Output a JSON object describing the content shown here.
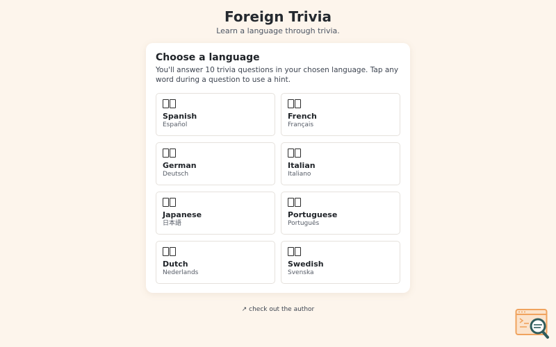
{
  "header": {
    "title": "Foreign Trivia",
    "subtitle": "Learn a language through trivia."
  },
  "card": {
    "title": "Choose a language",
    "description": "You'll answer 10 trivia questions in your chosen language. Tap any word during a question to use a hint.",
    "languages": [
      {
        "name": "Spanish",
        "native": "Español",
        "icon": "flag-icon"
      },
      {
        "name": "French",
        "native": "Français",
        "icon": "flag-icon"
      },
      {
        "name": "German",
        "native": "Deutsch",
        "icon": "flag-icon"
      },
      {
        "name": "Italian",
        "native": "Italiano",
        "icon": "flag-icon"
      },
      {
        "name": "Japanese",
        "native": "日本語",
        "icon": "flag-icon"
      },
      {
        "name": "Portuguese",
        "native": "Português",
        "icon": "flag-icon"
      },
      {
        "name": "Dutch",
        "native": "Nederlands",
        "icon": "flag-icon"
      },
      {
        "name": "Swedish",
        "native": "Svenska",
        "icon": "flag-icon"
      }
    ]
  },
  "footer": {
    "author_link": "↗ check out the author"
  },
  "colors": {
    "background": "#fdf5ec",
    "card": "#ffffff",
    "badge_orange": "#f0a35e",
    "badge_teal": "#2f5c5c"
  }
}
